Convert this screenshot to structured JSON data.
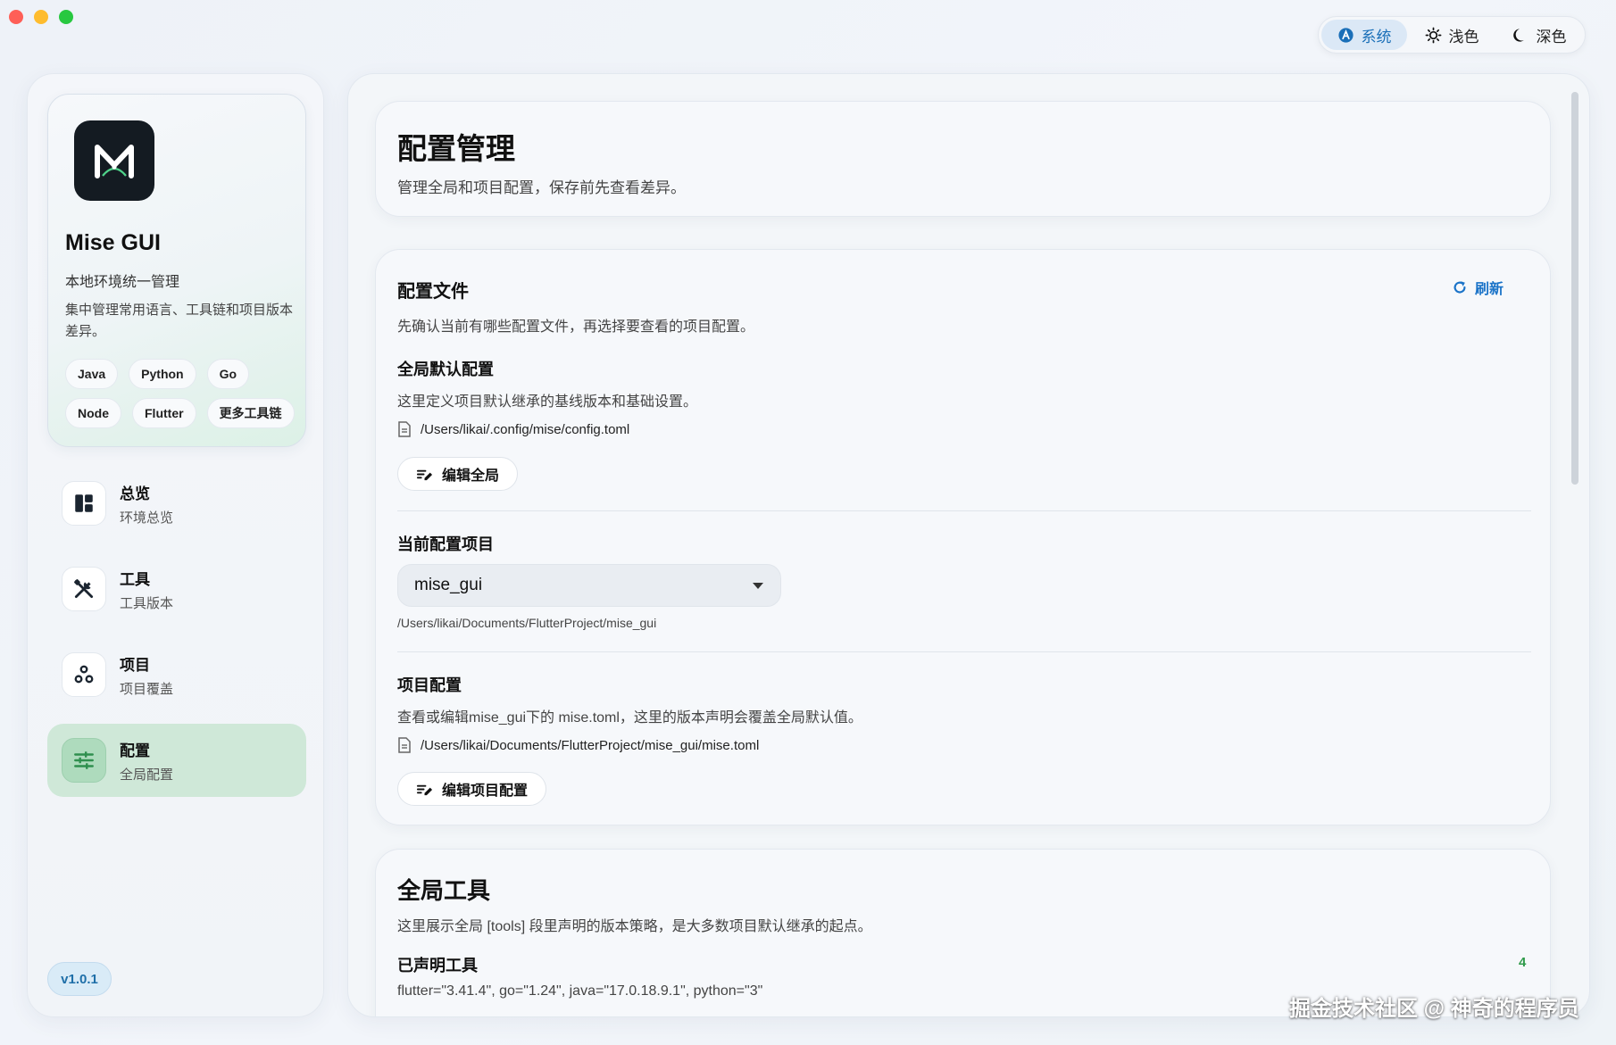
{
  "theme": {
    "options": [
      {
        "label": "系统",
        "icon": "system-theme-icon",
        "active": true
      },
      {
        "label": "浅色",
        "icon": "sun-icon",
        "active": false
      },
      {
        "label": "深色",
        "icon": "moon-icon",
        "active": false
      }
    ]
  },
  "sidebar": {
    "brand": {
      "title": "Mise GUI",
      "subtitle": "本地环境统一管理",
      "description": "集中管理常用语言、工具链和项目版本差异。",
      "chips": [
        "Java",
        "Python",
        "Go",
        "Node",
        "Flutter",
        "更多工具链"
      ]
    },
    "nav": [
      {
        "title": "总览",
        "subtitle": "环境总览",
        "icon": "dashboard-icon",
        "active": false
      },
      {
        "title": "工具",
        "subtitle": "工具版本",
        "icon": "tools-icon",
        "active": false
      },
      {
        "title": "项目",
        "subtitle": "项目覆盖",
        "icon": "project-icon",
        "active": false
      },
      {
        "title": "配置",
        "subtitle": "全局配置",
        "icon": "sliders-icon",
        "active": true
      }
    ],
    "version": "v1.0.1"
  },
  "main": {
    "header": {
      "title": "配置管理",
      "subtitle": "管理全局和项目配置，保存前先查看差异。"
    },
    "files": {
      "title": "配置文件",
      "description": "先确认当前有哪些配置文件，再选择要查看的项目配置。",
      "refresh_label": "刷新",
      "global": {
        "title": "全局默认配置",
        "description": "这里定义项目默认继承的基线版本和基础设置。",
        "path": "/Users/likai/.config/mise/config.toml",
        "button": "编辑全局"
      },
      "current_project": {
        "title": "当前配置项目",
        "selected": "mise_gui",
        "path": "/Users/likai/Documents/FlutterProject/mise_gui"
      },
      "project": {
        "title": "项目配置",
        "description": "查看或编辑mise_gui下的 mise.toml，这里的版本声明会覆盖全局默认值。",
        "path": "/Users/likai/Documents/FlutterProject/mise_gui/mise.toml",
        "button": "编辑项目配置"
      }
    },
    "tools": {
      "title": "全局工具",
      "description": "这里展示全局 [tools] 段里声明的版本策略，是大多数项目默认继承的起点。",
      "declared_title": "已声明工具",
      "declared_count": "4",
      "declared_values": "flutter=\"3.41.4\", go=\"1.24\", java=\"17.0.18.9.1\", python=\"3\""
    }
  },
  "watermark": "掘金技术社区 @ 神奇的程序员"
}
